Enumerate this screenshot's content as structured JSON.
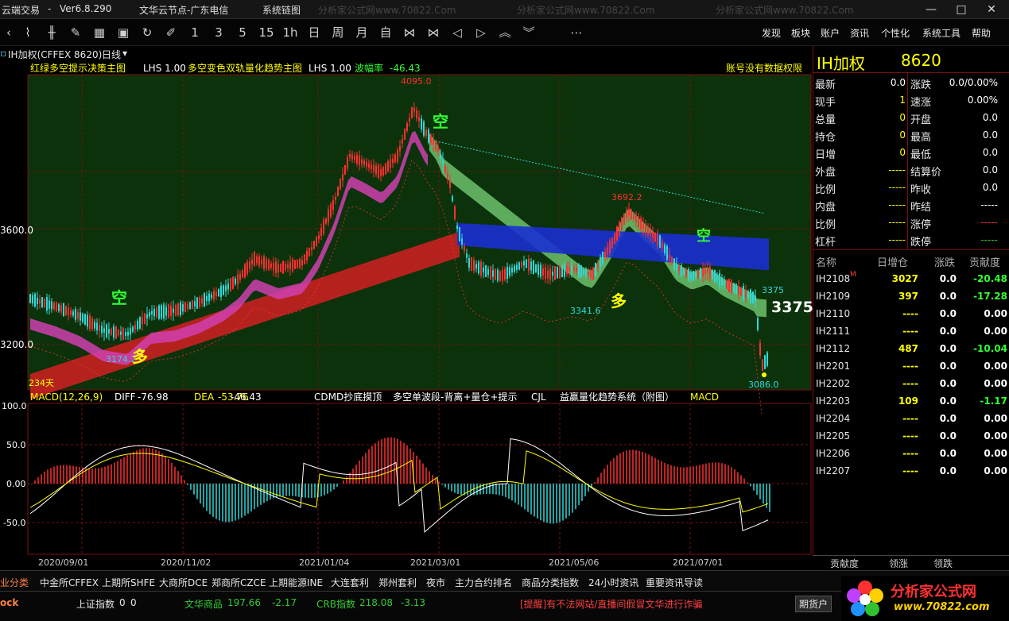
{
  "app": {
    "name": "云端交易",
    "version": "Ver6.8.290",
    "server": "文华云节点-广东电信",
    "sysmenu": "系统\u001b链图",
    "watermark": "分析家公式网www.70822.Com"
  },
  "toolbar": {
    "icons": [
      "chevron-left-icon",
      "line-chart-icon",
      "candle-icon",
      "brush-icon",
      "layout-icon",
      "save-icon",
      "refresh-icon",
      "draw-icon"
    ],
    "periods": [
      "1",
      "3",
      "5",
      "15",
      "1h",
      "日",
      "周",
      "月",
      "自"
    ],
    "nav_icons": [
      "zoom-fit-icon",
      "zoom-out-icon",
      "arrow-left-icon",
      "arrow-right-icon",
      "arrow-up-icon",
      "arrow-down-icon",
      "more-icon"
    ],
    "menus": [
      "发现",
      "板块",
      "账户",
      "资讯",
      "个性化",
      "系统工具",
      "帮助"
    ]
  },
  "symbol_bar": {
    "symbol": "IH加权(CFFEX 8620)",
    "period": "日线"
  },
  "main_chart": {
    "ind1_name": "红绿多空提示决策主图",
    "ind1_lhs": "LHS 1.00",
    "ind2_name": "多空变色双轨量化趋势主图",
    "ind2_lhs": "LHS 1.00",
    "swing_label": "波幅率",
    "swing_value": "-46.43",
    "right_note": "账号没有数据权限",
    "price_ticks": [
      "3600.0",
      "3200.0"
    ],
    "annotations": {
      "high": "4095.0",
      "mid_high": "3692.2",
      "low1": "3174.2",
      "low2": "3341.6",
      "low3": "3086.0",
      "right_small": "3375",
      "right_big": "3375",
      "days": "234天",
      "kong": "空",
      "duo": "多"
    }
  },
  "sub_chart": {
    "macd_name": "MACD(12,26,9)",
    "diff_label": "DIFF",
    "diff_value": "-76.98",
    "dea_label": "DEA",
    "dea_value": "-53.76",
    "macd_value": "-46.43",
    "tabs": [
      "CDMD抄底摸顶",
      "多空单波段-背离+量仓+提示",
      "CJL",
      "益赢量化趋势系统（附图）",
      "MACD"
    ],
    "y_ticks": [
      "100.0",
      "50.0",
      "0.00",
      "-50.0"
    ],
    "x_dates": [
      "2020/09/01",
      "2020/11/02",
      "2021/01/04",
      "2021/03/01",
      "2021/05/06",
      "2021/07/01"
    ]
  },
  "quote": {
    "title": "IH加权",
    "code": "8620",
    "left": [
      {
        "label": "最新",
        "value": "0.0",
        "color": "#ffffff"
      },
      {
        "label": "现手",
        "value": "1",
        "color": "#ffff00"
      },
      {
        "label": "总量",
        "value": "0",
        "color": "#ffff00"
      },
      {
        "label": "持仓",
        "value": "0",
        "color": "#ffff00"
      },
      {
        "label": "日增",
        "value": "0",
        "color": "#ffff00"
      },
      {
        "label": "外盘",
        "value": "-----",
        "color": "#ffff00"
      },
      {
        "label": "比例",
        "value": "-----",
        "color": "#ffff00"
      },
      {
        "label": "内盘",
        "value": "-----",
        "color": "#ffff00"
      },
      {
        "label": "比例",
        "value": "-----",
        "color": "#ffff00"
      },
      {
        "label": "杠杆",
        "value": "-----",
        "color": "#ffff00"
      }
    ],
    "right": [
      {
        "label": "涨跌",
        "value": "0.0/0.00%",
        "color": "#ffffff"
      },
      {
        "label": "速涨",
        "value": "0.00%",
        "color": "#ffffff"
      },
      {
        "label": "开盘",
        "value": "0.0",
        "color": "#ffffff"
      },
      {
        "label": "最高",
        "value": "0.0",
        "color": "#ffffff"
      },
      {
        "label": "最低",
        "value": "0.0",
        "color": "#ffffff"
      },
      {
        "label": "结算价",
        "value": "0.0",
        "color": "#ffffff"
      },
      {
        "label": "昨收",
        "value": "0.0",
        "color": "#ffffff"
      },
      {
        "label": "昨结",
        "value": "-----",
        "color": "#ffffff"
      },
      {
        "label": "涨停",
        "value": "-----",
        "color": "#ff3333"
      },
      {
        "label": "跌停",
        "value": "-----",
        "color": "#33cc33"
      }
    ]
  },
  "contracts": {
    "headers": [
      "名称",
      "日增仓",
      "涨跌",
      "贡献度"
    ],
    "rows": [
      {
        "name": "IH2108",
        "mark": "M",
        "inc": "3027",
        "chg": "0.0",
        "con": "-20.48",
        "con_color": "#33ff33"
      },
      {
        "name": "IH2109",
        "mark": "",
        "inc": "397",
        "chg": "0.0",
        "con": "-17.28",
        "con_color": "#33ff33"
      },
      {
        "name": "IH2110",
        "mark": "",
        "inc": "----",
        "chg": "0.0",
        "con": "0.00",
        "con_color": "#ffffff"
      },
      {
        "name": "IH2111",
        "mark": "",
        "inc": "----",
        "chg": "0.0",
        "con": "0.00",
        "con_color": "#ffffff"
      },
      {
        "name": "IH2112",
        "mark": "",
        "inc": "487",
        "chg": "0.0",
        "con": "-10.04",
        "con_color": "#33ff33"
      },
      {
        "name": "IH2201",
        "mark": "",
        "inc": "----",
        "chg": "0.0",
        "con": "0.00",
        "con_color": "#ffffff"
      },
      {
        "name": "IH2202",
        "mark": "",
        "inc": "----",
        "chg": "0.0",
        "con": "0.00",
        "con_color": "#ffffff"
      },
      {
        "name": "IH2203",
        "mark": "",
        "inc": "109",
        "chg": "0.0",
        "con": "-1.17",
        "con_color": "#33ff33"
      },
      {
        "name": "IH2204",
        "mark": "",
        "inc": "----",
        "chg": "0.0",
        "con": "0.00",
        "con_color": "#ffffff"
      },
      {
        "name": "IH2205",
        "mark": "",
        "inc": "----",
        "chg": "0.0",
        "con": "0.00",
        "con_color": "#ffffff"
      },
      {
        "name": "IH2206",
        "mark": "",
        "inc": "----",
        "chg": "0.0",
        "con": "0.00",
        "con_color": "#ffffff"
      },
      {
        "name": "IH2207",
        "mark": "",
        "inc": "----",
        "chg": "0.0",
        "con": "0.00",
        "con_color": "#ffffff"
      }
    ],
    "bottom_tabs": [
      "贡献度",
      "领涨",
      "领跌"
    ]
  },
  "bottom_tabs": [
    "业分类",
    "中金所CFFEX",
    "上期所SHFE",
    "大商所DCE",
    "郑商所CZCE",
    "上期能源INE",
    "大连套利",
    "郑州套利",
    "夜市",
    "主力合约排名",
    "商品分类指数",
    "24小时资讯",
    "重要资讯导读"
  ],
  "status": {
    "left": "ock",
    "sh_label": "上证指数",
    "sh_v1": "0",
    "sh_v2": "0",
    "wh_label": "文华商品",
    "wh_v1": "197.66",
    "wh_v2": "-2.17",
    "crb_label": "CRB指数",
    "crb_v1": "218.08",
    "crb_v2": "-3.13",
    "notice": "[提醒]有不法网站/直播间假冒文华进行诈骗",
    "account": "期货户",
    "logo_text": "分析家公式网",
    "logo_url": "www.70822.com"
  },
  "colors": {
    "up": "#ff3030",
    "down": "#30d8d8",
    "bg_green": "#0d3b0d",
    "yellow": "#ffff00",
    "blue": "#1a2fd0",
    "pink": "#e040c0"
  }
}
